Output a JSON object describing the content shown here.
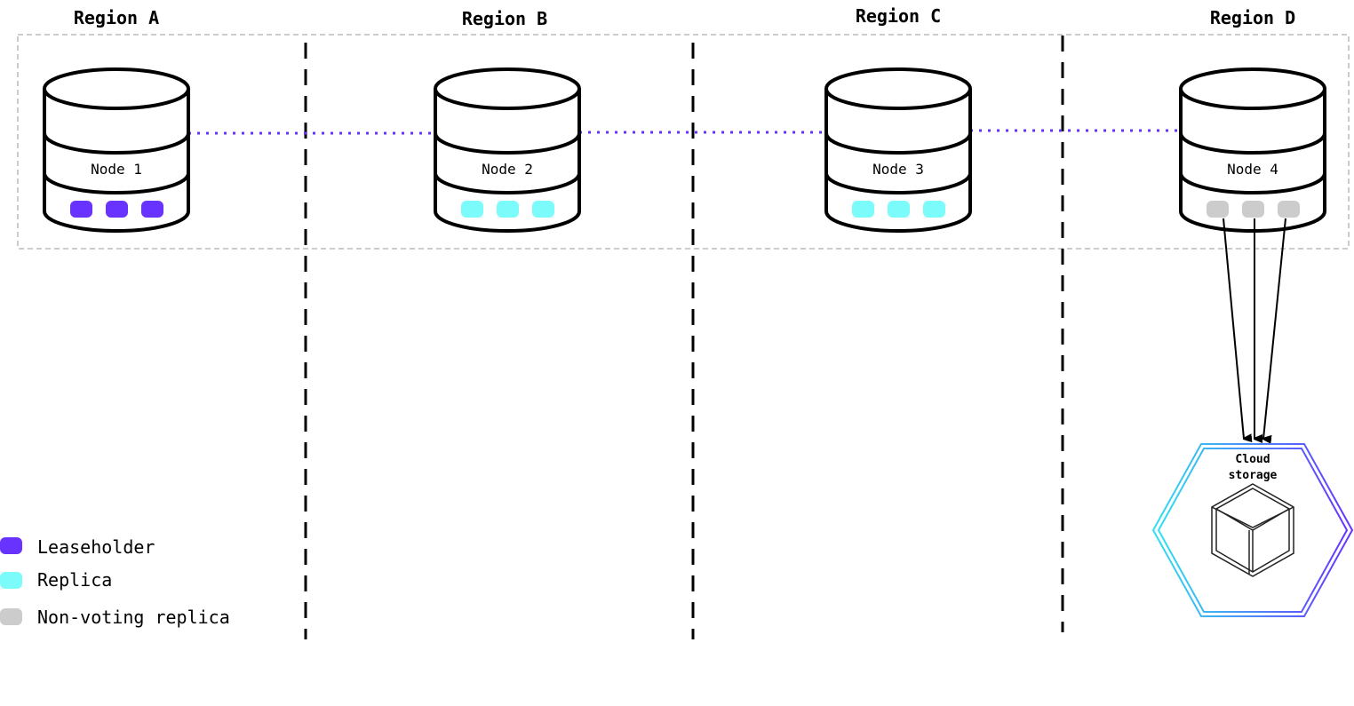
{
  "regions": [
    {
      "title": "Region A",
      "node": "Node 1",
      "replica_type": "leaseholder"
    },
    {
      "title": "Region B",
      "node": "Node 2",
      "replica_type": "replica"
    },
    {
      "title": "Region C",
      "node": "Node 3",
      "replica_type": "replica"
    },
    {
      "title": "Region D",
      "node": "Node 4",
      "replica_type": "non-voting"
    }
  ],
  "replicas_per_node": 3,
  "cloud": {
    "line1": "Cloud",
    "line2": "storage"
  },
  "legend": [
    {
      "label": "Leaseholder",
      "type": "leaseholder"
    },
    {
      "label": "Replica",
      "type": "replica"
    },
    {
      "label": "Non-voting replica",
      "type": "non-voting"
    }
  ],
  "colors": {
    "leaseholder": "#6933ff",
    "replica": "#7cfbfb",
    "non-voting": "#cccccc",
    "link": "#6933ff",
    "hex_start": "#2fe0f0",
    "hex_end": "#6933ff"
  }
}
